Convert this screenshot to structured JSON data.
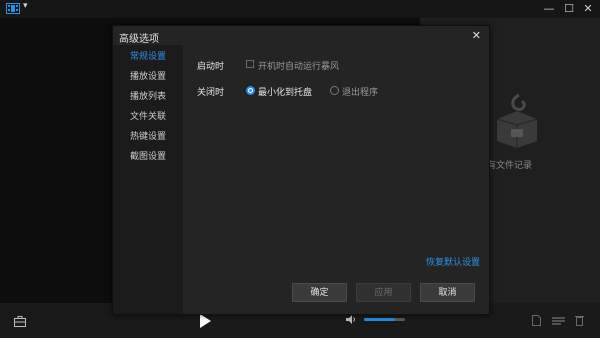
{
  "window": {
    "minimize": "—",
    "maximize": "☐",
    "close": "✕",
    "empty_history_text": "有文件记录"
  },
  "dialog": {
    "title": "高级选项",
    "close": "✕",
    "nav": [
      {
        "label": "常规设置",
        "active": true
      },
      {
        "label": "播放设置",
        "active": false
      },
      {
        "label": "播放列表",
        "active": false
      },
      {
        "label": "文件关联",
        "active": false
      },
      {
        "label": "热键设置",
        "active": false
      },
      {
        "label": "截图设置",
        "active": false
      }
    ],
    "startup": {
      "label": "启动时",
      "option": "开机时自动运行暴风",
      "checked": false
    },
    "on_close": {
      "label": "关闭时",
      "options": [
        {
          "label": "最小化到托盘",
          "selected": true
        },
        {
          "label": "退出程序",
          "selected": false
        }
      ]
    },
    "restore_defaults": "恢复默认设置",
    "buttons": {
      "ok": "确定",
      "apply": "应用",
      "cancel": "取消"
    }
  },
  "player": {
    "volume": 0.75
  },
  "colors": {
    "accent": "#2f8fe4"
  }
}
